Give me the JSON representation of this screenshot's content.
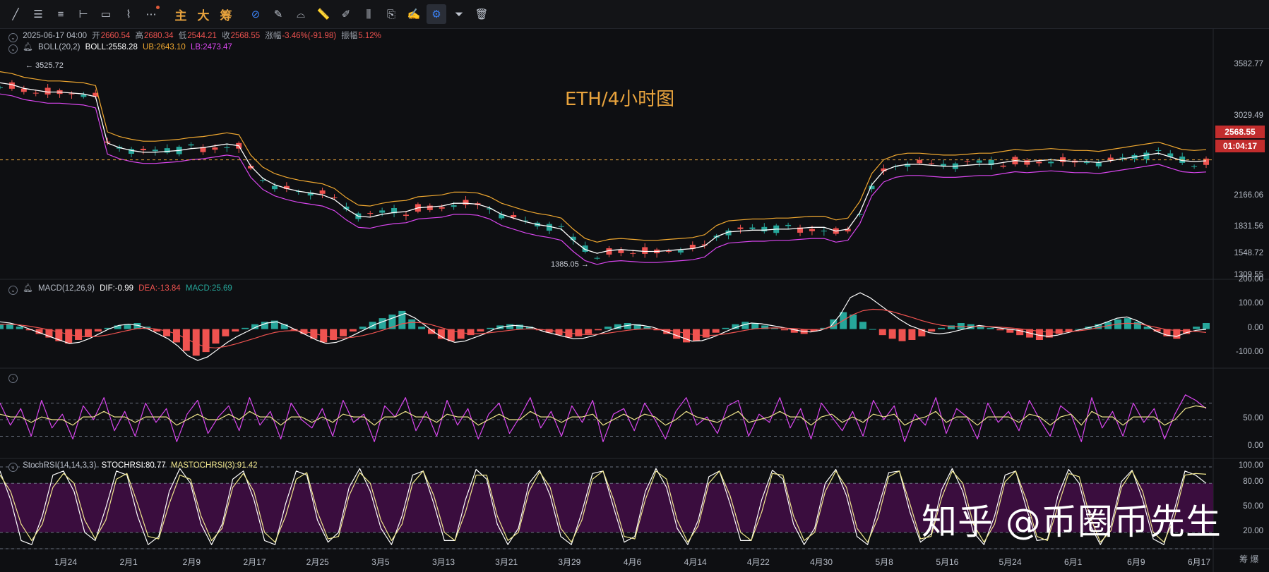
{
  "toolbar": {
    "tools": [
      {
        "name": "trendline-icon",
        "glyph": "╱"
      },
      {
        "name": "horizontal-lines-icon",
        "glyph": "☰"
      },
      {
        "name": "parallel-lines-icon",
        "glyph": "≡"
      },
      {
        "name": "ray-icon",
        "glyph": "⊢"
      },
      {
        "name": "rectangle-icon",
        "glyph": "▭"
      },
      {
        "name": "pattern-icon",
        "glyph": "⌇"
      },
      {
        "name": "more-icon",
        "glyph": "⋯"
      }
    ],
    "text_buttons": [
      "主",
      "大",
      "筹"
    ],
    "tools2": [
      {
        "name": "measure-icon",
        "glyph": "⊘"
      },
      {
        "name": "pen-icon",
        "glyph": "✎"
      },
      {
        "name": "magnet-icon",
        "glyph": "⌓"
      },
      {
        "name": "ruler-icon",
        "glyph": "📏"
      },
      {
        "name": "brush-icon",
        "glyph": "✐"
      },
      {
        "name": "candles-icon",
        "glyph": "⫼"
      },
      {
        "name": "copy-icon",
        "glyph": "⎘"
      },
      {
        "name": "note-icon",
        "glyph": "✍"
      },
      {
        "name": "settings-icon",
        "glyph": "⚙"
      },
      {
        "name": "filter-icon",
        "glyph": "⏷"
      },
      {
        "name": "trash-icon",
        "glyph": "🗑"
      }
    ]
  },
  "header": {
    "datetime": "2025-06-17 04:00",
    "open_label": "开",
    "open": "2660.54",
    "high_label": "高",
    "high": "2680.34",
    "low_label": "低",
    "low": "2544.21",
    "close_label": "收",
    "close": "2568.55",
    "change_label": "涨幅",
    "change": "-3.46%(-91.98)",
    "amp_label": "振幅",
    "amp": "5.12%"
  },
  "boll": {
    "name": "BOLL(20,2)",
    "mid": "BOLL:2558.28",
    "ub": "UB:2643.10",
    "lb": "LB:2473.47"
  },
  "macd": {
    "name": "MACD(12,26,9)",
    "dif": "DIF:-0.99",
    "dea": "DEA:-13.84",
    "macd": "MACD:25.69"
  },
  "stochrsi": {
    "name": "StochRSI(14,14,3,3)",
    "k": "STOCHRSI:80.77",
    "d": "MASTOCHRSI(3):91.42"
  },
  "title": "ETH/4小时图",
  "watermark": "知乎 @币圈币先生",
  "price_tag": "2568.55",
  "countdown_tag": "01:04:17",
  "high_marker": "3525.72",
  "low_marker": "1385.05",
  "bottom_right": "筹 爆",
  "colors": {
    "up": "#26a69a",
    "down": "#ef5350",
    "boll_mid": "#ffffff",
    "boll_ub": "#f0a830",
    "boll_lb": "#d946ef",
    "dif": "#ffffff",
    "dea": "#ef5350",
    "rsi_k": "#d946ef",
    "rsi_d": "#f0e68c",
    "stoch_fill": "#3a0d3e"
  },
  "chart_data": [
    {
      "type": "line",
      "title": "ETH/4小时图",
      "ylim": [
        1309.55,
        3700
      ],
      "y_ticks": [
        "3582.77",
        "3029.49",
        "2568.55",
        "2166.06",
        "1831.56",
        "1548.72",
        "1309.55"
      ],
      "x_ticks": [
        "1月24",
        "2月1",
        "2月9",
        "2月17",
        "2月25",
        "3月5",
        "3月13",
        "3月21",
        "3月29",
        "4月6",
        "4月14",
        "4月22",
        "4月30",
        "5月8",
        "5月16",
        "5月24",
        "6月1",
        "6月9",
        "6月17"
      ],
      "series": [
        {
          "name": "BOLL",
          "values": [
            3400,
            3380,
            3340,
            3320,
            3300,
            3300,
            3290,
            3280,
            3250,
            2750,
            2700,
            2670,
            2650,
            2650,
            2660,
            2670,
            2690,
            2700,
            2720,
            2740,
            2720,
            2500,
            2370,
            2300,
            2260,
            2230,
            2210,
            2190,
            2140,
            2040,
            1960,
            1950,
            1980,
            2000,
            2010,
            2050,
            2060,
            2070,
            2100,
            2100,
            2090,
            2050,
            1980,
            1940,
            1900,
            1870,
            1850,
            1820,
            1700,
            1600,
            1560,
            1590,
            1600,
            1590,
            1580,
            1580,
            1590,
            1600,
            1610,
            1640,
            1740,
            1790,
            1800,
            1810,
            1810,
            1820,
            1820,
            1830,
            1840,
            1840,
            1800,
            1820,
            2000,
            2300,
            2450,
            2500,
            2520,
            2520,
            2510,
            2500,
            2500,
            2510,
            2520,
            2520,
            2540,
            2560,
            2550,
            2560,
            2570,
            2560,
            2550,
            2550,
            2540,
            2560,
            2580,
            2600,
            2620,
            2640,
            2600,
            2560,
            2550,
            2558
          ]
        }
      ],
      "markers": {
        "high": "3525.72",
        "low": "1385.05"
      }
    },
    {
      "type": "bar",
      "title": "MACD(12,26,9)",
      "ylim": [
        -150,
        200
      ],
      "y_ticks": [
        "200.00",
        "100.00",
        "0.00",
        "-100.00"
      ],
      "series": [
        {
          "name": "MACD",
          "values": [
            18,
            22,
            10,
            -5,
            -20,
            -35,
            -50,
            -60,
            -45,
            -30,
            -10,
            5,
            15,
            20,
            25,
            10,
            -10,
            -30,
            -55,
            -90,
            -110,
            -95,
            -60,
            -30,
            -10,
            5,
            20,
            30,
            35,
            20,
            -5,
            -20,
            -40,
            -55,
            -45,
            -30,
            -10,
            10,
            30,
            45,
            60,
            75,
            40,
            10,
            -20,
            -40,
            -50,
            -40,
            -25,
            -10,
            5,
            15,
            20,
            18,
            10,
            -5,
            -15,
            -25,
            -35,
            -30,
            -20,
            -5,
            10,
            20,
            25,
            20,
            10,
            -5,
            -20,
            -40,
            -55,
            -50,
            -35,
            -15,
            5,
            20,
            30,
            25,
            15,
            5,
            -5,
            -15,
            -20,
            -10,
            5,
            40,
            70,
            60,
            30,
            0,
            -25,
            -40,
            -50,
            -45,
            -30,
            -10,
            5,
            15,
            25,
            20,
            10,
            5,
            -5,
            -15,
            -25,
            -35,
            -45,
            -35,
            -20,
            -10,
            0,
            10,
            20,
            30,
            40,
            45,
            30,
            10,
            -10,
            -30,
            -40,
            -20,
            10,
            25
          ]
        },
        {
          "name": "DIF",
          "values": [
            30,
            25,
            15,
            0,
            -15,
            -30,
            -45,
            -60,
            -55,
            -40,
            -20,
            0,
            15,
            20,
            15,
            0,
            -20,
            -40,
            -70,
            -110,
            -130,
            -115,
            -85,
            -55,
            -30,
            -10,
            10,
            25,
            30,
            15,
            -5,
            -25,
            -45,
            -60,
            -55,
            -40,
            -20,
            0,
            20,
            35,
            50,
            65,
            45,
            15,
            -15,
            -40,
            -55,
            -50,
            -35,
            -20,
            0,
            10,
            15,
            12,
            5,
            -10,
            -20,
            -30,
            -40,
            -38,
            -28,
            -15,
            0,
            12,
            18,
            15,
            8,
            -5,
            -20,
            -35,
            -50,
            -48,
            -35,
            -18,
            0,
            15,
            25,
            22,
            15,
            8,
            0,
            -8,
            -12,
            -5,
            10,
            60,
            130,
            150,
            130,
            100,
            70,
            40,
            15,
            0,
            -15,
            -20,
            -15,
            -5,
            5,
            15,
            10,
            5,
            0,
            -5,
            -15,
            -25,
            -30,
            -25,
            -15,
            -5,
            5,
            15,
            30,
            45,
            50,
            35,
            15,
            -10,
            -25,
            -30,
            -15,
            -5,
            -1
          ]
        },
        {
          "name": "DEA",
          "values": [
            20,
            20,
            17,
            12,
            5,
            -3,
            -12,
            -22,
            -30,
            -32,
            -30,
            -24,
            -15,
            -6,
            2,
            4,
            0,
            -8,
            -20,
            -40,
            -60,
            -75,
            -78,
            -72,
            -62,
            -50,
            -38,
            -25,
            -14,
            -8,
            -6,
            -10,
            -18,
            -28,
            -35,
            -37,
            -34,
            -27,
            -17,
            -5,
            8,
            22,
            28,
            26,
            18,
            6,
            -6,
            -15,
            -19,
            -19,
            -15,
            -10,
            -5,
            -1,
            1,
            -1,
            -5,
            -10,
            -16,
            -21,
            -23,
            -21,
            -17,
            -11,
            -5,
            -1,
            1,
            0,
            -4,
            -10,
            -18,
            -24,
            -27,
            -25,
            -20,
            -13,
            -5,
            1,
            4,
            5,
            4,
            2,
            -1,
            -2,
            0,
            12,
            36,
            60,
            76,
            82,
            80,
            72,
            60,
            48,
            35,
            24,
            16,
            11,
            10,
            11,
            11,
            10,
            8,
            5,
            1,
            -4,
            -9,
            -12,
            -13,
            -11,
            -7,
            -2,
            6,
            14,
            21,
            24,
            22,
            15,
            6,
            -2,
            -6,
            -7,
            -10,
            -14
          ]
        }
      ]
    },
    {
      "type": "line",
      "title": "RSI",
      "ylim": [
        -10,
        110
      ],
      "y_ticks": [
        "50.00",
        "0.00"
      ],
      "series": [
        {
          "name": "RSI-K",
          "values": [
            80,
            40,
            70,
            20,
            85,
            35,
            60,
            15,
            75,
            50,
            90,
            30,
            65,
            20,
            80,
            45,
            70,
            10,
            60,
            85,
            25,
            55,
            75,
            30,
            90,
            40,
            65,
            15,
            80,
            50,
            35,
            70,
            20,
            85,
            45,
            60,
            10,
            75,
            55,
            90,
            30,
            65,
            20,
            85,
            40,
            70,
            15,
            60,
            80,
            25,
            55,
            90,
            35,
            65,
            20,
            75,
            45,
            85,
            10,
            60,
            70,
            30,
            80,
            50,
            15,
            65,
            90,
            40,
            55,
            25,
            75,
            85,
            20,
            60,
            45,
            90,
            35,
            70,
            15,
            80,
            55,
            30,
            65,
            20,
            85,
            50,
            75,
            10,
            60,
            40,
            90,
            25,
            70,
            55,
            15,
            80,
            45,
            65,
            30,
            85,
            50,
            20,
            75,
            60,
            10,
            90,
            35,
            65,
            20,
            80,
            45,
            70,
            15,
            60,
            95,
            85,
            70
          ]
        },
        {
          "name": "RSI-D",
          "values": [
            60,
            55,
            55,
            45,
            55,
            50,
            50,
            40,
            55,
            55,
            65,
            55,
            55,
            45,
            55,
            55,
            55,
            40,
            50,
            60,
            50,
            50,
            60,
            50,
            65,
            55,
            55,
            40,
            55,
            55,
            45,
            55,
            45,
            60,
            55,
            55,
            40,
            55,
            55,
            65,
            55,
            55,
            45,
            60,
            55,
            55,
            40,
            50,
            60,
            50,
            50,
            65,
            55,
            55,
            45,
            55,
            55,
            60,
            40,
            50,
            60,
            50,
            60,
            55,
            40,
            50,
            65,
            55,
            50,
            45,
            55,
            65,
            45,
            50,
            55,
            65,
            55,
            55,
            40,
            55,
            60,
            45,
            55,
            45,
            60,
            55,
            60,
            40,
            50,
            55,
            65,
            45,
            55,
            55,
            40,
            55,
            55,
            55,
            45,
            60,
            55,
            40,
            55,
            60,
            40,
            65,
            55,
            55,
            40,
            55,
            55,
            55,
            40,
            50,
            70,
            75,
            72
          ]
        }
      ]
    },
    {
      "type": "line",
      "title": "StochRSI(14,14,3,3)",
      "ylim": [
        0,
        100
      ],
      "y_ticks": [
        "100.00",
        "80.00",
        "50.00",
        "20.00"
      ],
      "series": [
        {
          "name": "STOCHRSI",
          "values": [
            95,
            60,
            10,
            5,
            40,
            90,
            95,
            70,
            20,
            10,
            50,
            95,
            90,
            40,
            5,
            15,
            70,
            98,
            80,
            30,
            5,
            30,
            85,
            95,
            60,
            10,
            5,
            55,
            95,
            90,
            35,
            8,
            20,
            75,
            98,
            70,
            25,
            5,
            40,
            90,
            95,
            55,
            10,
            10,
            60,
            97,
            85,
            30,
            5,
            25,
            80,
            96,
            65,
            15,
            5,
            45,
            92,
            95,
            50,
            8,
            15,
            70,
            98,
            75,
            25,
            5,
            35,
            88,
            95,
            55,
            10,
            10,
            60,
            96,
            85,
            30,
            5,
            25,
            80,
            97,
            65,
            15,
            5,
            50,
            93,
            95,
            45,
            8,
            18,
            72,
            98,
            70,
            20,
            5,
            40,
            90,
            95,
            50,
            10,
            12,
            65,
            97,
            80,
            30,
            5,
            28,
            82,
            96,
            60,
            12,
            5,
            48,
            95,
            90,
            80
          ]
        },
        {
          "name": "MASTOCHRSI(3)",
          "values": [
            90,
            70,
            30,
            10,
            30,
            75,
            92,
            80,
            35,
            12,
            35,
            85,
            92,
            55,
            15,
            12,
            55,
            90,
            85,
            40,
            10,
            25,
            75,
            92,
            70,
            20,
            8,
            40,
            85,
            93,
            45,
            12,
            15,
            65,
            93,
            80,
            35,
            10,
            30,
            80,
            95,
            65,
            20,
            10,
            45,
            90,
            90,
            40,
            10,
            20,
            70,
            94,
            75,
            25,
            8,
            35,
            85,
            95,
            60,
            15,
            12,
            60,
            95,
            85,
            35,
            8,
            28,
            80,
            95,
            65,
            20,
            10,
            45,
            92,
            90,
            40,
            10,
            20,
            70,
            95,
            75,
            25,
            8,
            38,
            88,
            95,
            55,
            12,
            15,
            62,
            95,
            80,
            30,
            8,
            30,
            82,
            95,
            60,
            15,
            10,
            52,
            92,
            88,
            40,
            8,
            22,
            75,
            95,
            70,
            20,
            8,
            38,
            90,
            92,
            91
          ]
        }
      ],
      "bands": [
        20,
        80
      ]
    }
  ]
}
